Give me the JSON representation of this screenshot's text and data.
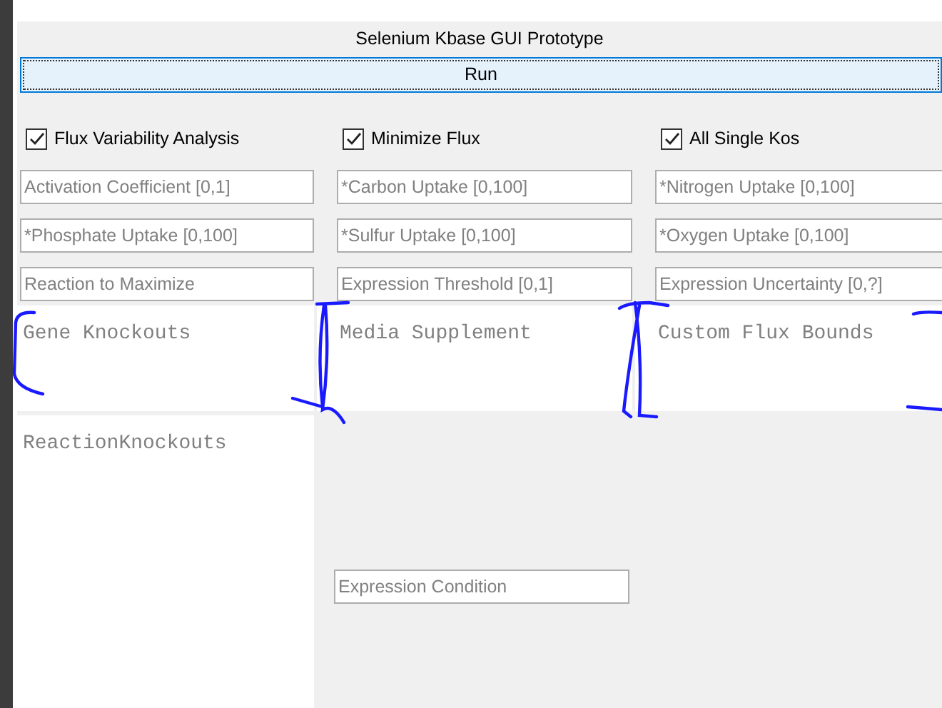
{
  "window": {
    "title": "Selenium Kbase GUI Prototype"
  },
  "run_button": {
    "label": "Run"
  },
  "options": [
    {
      "label": "Flux Variability Analysis",
      "checked": true
    },
    {
      "label": "Minimize Flux",
      "checked": true
    },
    {
      "label": "All Single Kos",
      "checked": true
    }
  ],
  "fields": [
    {
      "placeholder": "Activation Coefficient [0,1]"
    },
    {
      "placeholder": "*Carbon Uptake [0,100]"
    },
    {
      "placeholder": "*Nitrogen Uptake [0,100]"
    },
    {
      "placeholder": "*Phosphate Uptake [0,100]"
    },
    {
      "placeholder": "*Sulfur Uptake [0,100]"
    },
    {
      "placeholder": "*Oxygen Uptake [0,100]"
    },
    {
      "placeholder": "Reaction to Maximize"
    },
    {
      "placeholder": "Expression Threshold [0,1]"
    },
    {
      "placeholder": "Expression Uncertainty [0,?]"
    }
  ],
  "text_areas": [
    {
      "placeholder": "Gene Knockouts"
    },
    {
      "placeholder": "Media Supplement"
    },
    {
      "placeholder": "Custom Flux Bounds"
    }
  ],
  "reaction_knockouts": {
    "placeholder": "ReactionKnockouts"
  },
  "expression_condition": {
    "placeholder": "Expression Condition"
  }
}
